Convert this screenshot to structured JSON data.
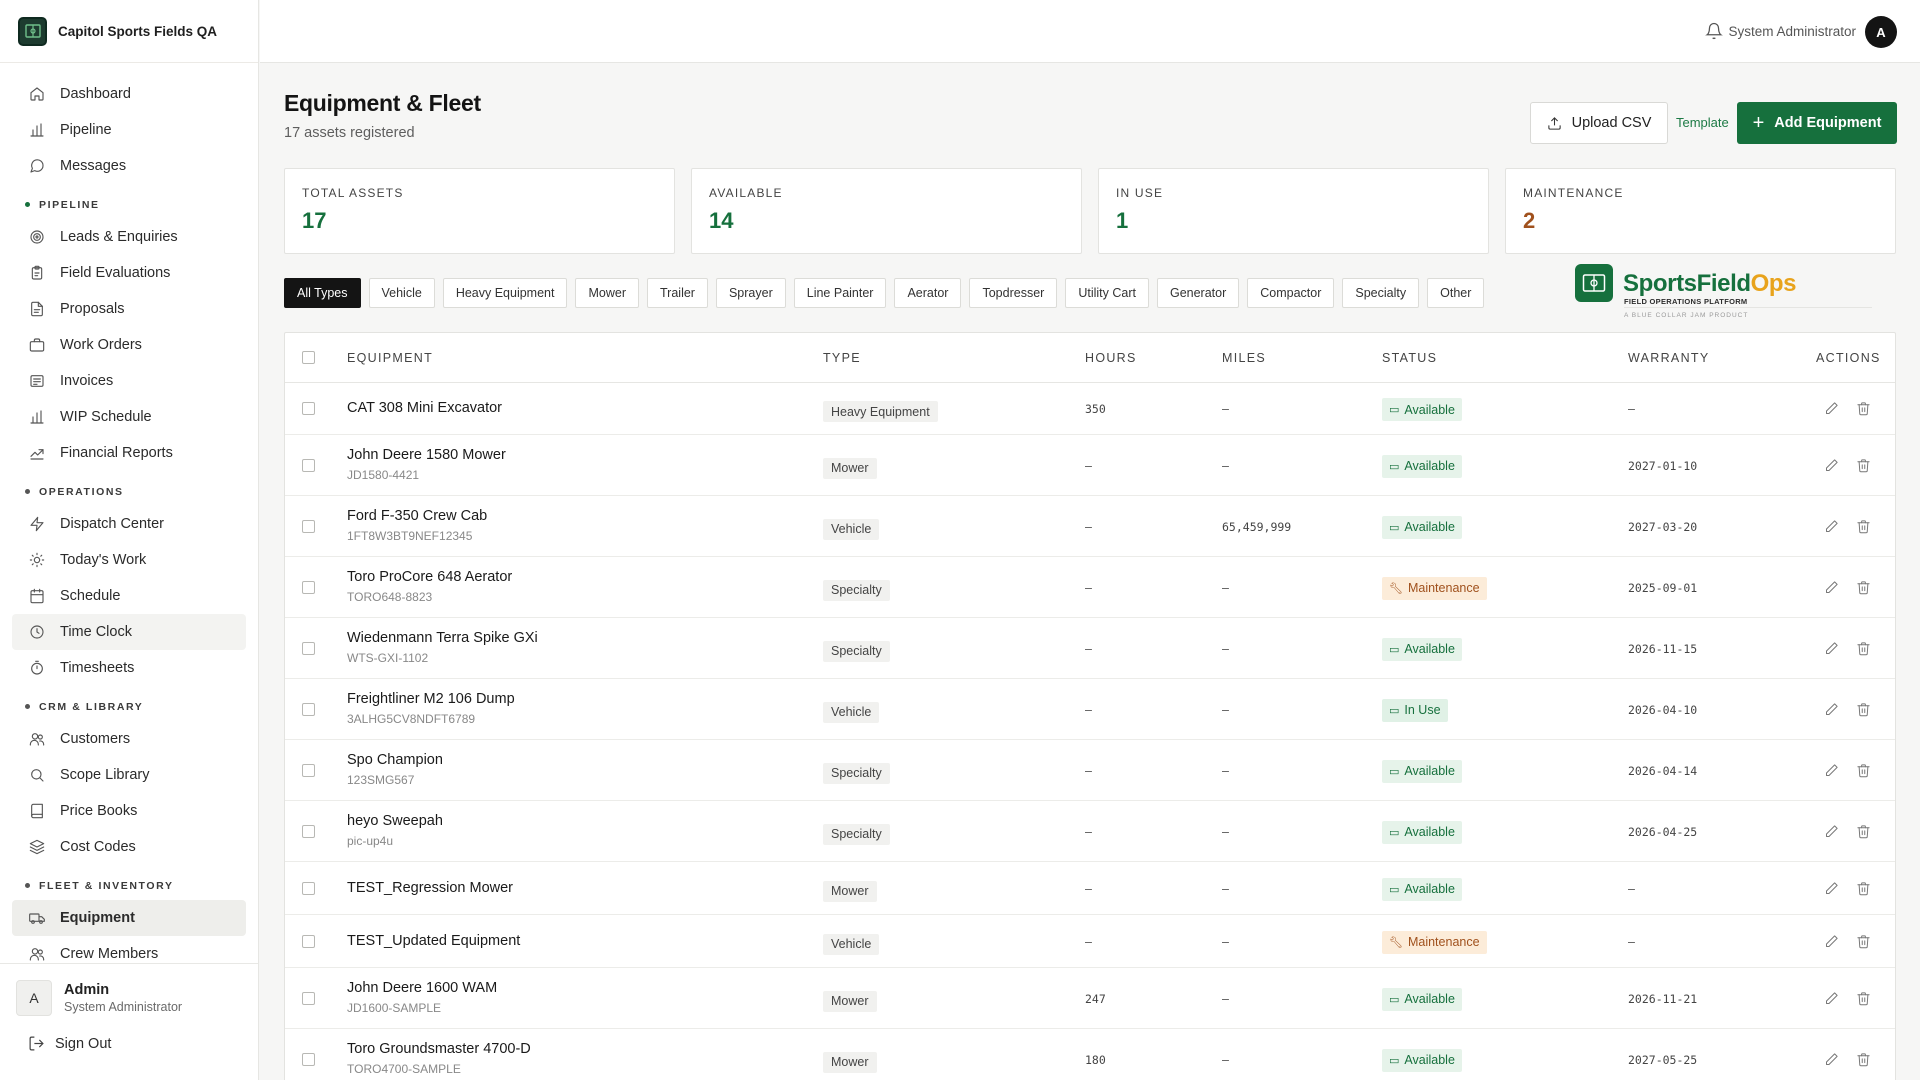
{
  "brand": {
    "name": "Capitol Sports Fields QA"
  },
  "nav": {
    "top": [
      {
        "label": "Dashboard",
        "icon": "home-icon"
      },
      {
        "label": "Pipeline",
        "icon": "bar-chart-icon"
      },
      {
        "label": "Messages",
        "icon": "message-icon"
      }
    ],
    "sections": [
      {
        "title": "PIPELINE",
        "dot": "#16703d",
        "items": [
          {
            "label": "Leads & Enquiries",
            "icon": "target-icon"
          },
          {
            "label": "Field Evaluations",
            "icon": "clipboard-icon"
          },
          {
            "label": "Proposals",
            "icon": "document-icon"
          },
          {
            "label": "Work Orders",
            "icon": "briefcase-icon"
          },
          {
            "label": "Invoices",
            "icon": "invoice-icon"
          },
          {
            "label": "WIP Schedule",
            "icon": "bar-chart-icon"
          },
          {
            "label": "Financial Reports",
            "icon": "trend-icon"
          }
        ]
      },
      {
        "title": "OPERATIONS",
        "dot": "#555555",
        "items": [
          {
            "label": "Dispatch Center",
            "icon": "lightning-icon"
          },
          {
            "label": "Today's Work",
            "icon": "sun-icon"
          },
          {
            "label": "Schedule",
            "icon": "calendar-icon"
          },
          {
            "label": "Time Clock",
            "icon": "clock-icon"
          },
          {
            "label": "Timesheets",
            "icon": "stopwatch-icon"
          }
        ]
      },
      {
        "title": "CRM & LIBRARY",
        "dot": "#555555",
        "items": [
          {
            "label": "Customers",
            "icon": "users-icon"
          },
          {
            "label": "Scope Library",
            "icon": "search-icon"
          },
          {
            "label": "Price Books",
            "icon": "book-icon"
          },
          {
            "label": "Cost Codes",
            "icon": "layers-icon"
          }
        ]
      },
      {
        "title": "FLEET & INVENTORY",
        "dot": "#555555",
        "items": [
          {
            "label": "Equipment",
            "icon": "truck-icon"
          },
          {
            "label": "Crew Members",
            "icon": "users-icon"
          }
        ]
      }
    ]
  },
  "footer": {
    "avatar": "A",
    "name": "Admin",
    "role": "System Administrator",
    "signout": "Sign Out"
  },
  "topbar": {
    "user": "System Administrator",
    "avatar": "A"
  },
  "page": {
    "title": "Equipment & Fleet",
    "subtitle": "17 assets registered",
    "upload_label": "Upload CSV",
    "template_label": "Template",
    "add_label": "Add Equipment"
  },
  "stats": [
    {
      "label": "TOTAL ASSETS",
      "value": "17",
      "color": "#16703d"
    },
    {
      "label": "AVAILABLE",
      "value": "14",
      "color": "#16703d"
    },
    {
      "label": "IN USE",
      "value": "1",
      "color": "#16703d"
    },
    {
      "label": "MAINTENANCE",
      "value": "2",
      "color": "#a0511d"
    }
  ],
  "filters": [
    "All Types",
    "Vehicle",
    "Heavy Equipment",
    "Mower",
    "Trailer",
    "Sprayer",
    "Line Painter",
    "Aerator",
    "Topdresser",
    "Utility Cart",
    "Generator",
    "Compactor",
    "Specialty",
    "Other"
  ],
  "ops_logo": {
    "name_a": "SportsField",
    "name_b": "Ops",
    "tagline": "FIELD OPERATIONS PLATFORM",
    "sub": "A BLUE COLLAR JAM PRODUCT"
  },
  "table": {
    "headers": {
      "equipment": "EQUIPMENT",
      "type": "TYPE",
      "hours": "HOURS",
      "miles": "MILES",
      "status": "STATUS",
      "warranty": "WARRANTY",
      "actions": "ACTIONS"
    },
    "rows": [
      {
        "name": "CAT 308 Mini Excavator",
        "sub": "",
        "type": "Heavy Equipment",
        "hours": "350",
        "miles": "–",
        "status": "Available",
        "warranty": "–"
      },
      {
        "name": "John Deere 1580 Mower",
        "sub": "JD1580-4421",
        "type": "Mower",
        "hours": "–",
        "miles": "–",
        "status": "Available",
        "warranty": "2027-01-10"
      },
      {
        "name": "Ford F-350 Crew Cab",
        "sub": "1FT8W3BT9NEF12345",
        "type": "Vehicle",
        "hours": "–",
        "miles": "65,459,999",
        "status": "Available",
        "warranty": "2027-03-20"
      },
      {
        "name": "Toro ProCore 648 Aerator",
        "sub": "TORO648-8823",
        "type": "Specialty",
        "hours": "–",
        "miles": "–",
        "status": "Maintenance",
        "warranty": "2025-09-01"
      },
      {
        "name": "Wiedenmann Terra Spike GXi",
        "sub": "WTS-GXI-1102",
        "type": "Specialty",
        "hours": "–",
        "miles": "–",
        "status": "Available",
        "warranty": "2026-11-15"
      },
      {
        "name": "Freightliner M2 106 Dump",
        "sub": "3ALHG5CV8NDFT6789",
        "type": "Vehicle",
        "hours": "–",
        "miles": "–",
        "status": "In Use",
        "warranty": "2026-04-10"
      },
      {
        "name": "Spo Champion",
        "sub": "123SMG567",
        "type": "Specialty",
        "hours": "–",
        "miles": "–",
        "status": "Available",
        "warranty": "2026-04-14"
      },
      {
        "name": "heyo Sweepah",
        "sub": "pic-up4u",
        "type": "Specialty",
        "hours": "–",
        "miles": "–",
        "status": "Available",
        "warranty": "2026-04-25"
      },
      {
        "name": "TEST_Regression Mower",
        "sub": "",
        "type": "Mower",
        "hours": "–",
        "miles": "–",
        "status": "Available",
        "warranty": "–"
      },
      {
        "name": "TEST_Updated Equipment",
        "sub": "",
        "type": "Vehicle",
        "hours": "–",
        "miles": "–",
        "status": "Maintenance",
        "warranty": "–"
      },
      {
        "name": "John Deere 1600 WAM",
        "sub": "JD1600-SAMPLE",
        "type": "Mower",
        "hours": "247",
        "miles": "–",
        "status": "Available",
        "warranty": "2026-11-21"
      },
      {
        "name": "Toro Groundsmaster 4700-D",
        "sub": "TORO4700-SAMPLE",
        "type": "Mower",
        "hours": "180",
        "miles": "–",
        "status": "Available",
        "warranty": "2027-05-25"
      }
    ]
  }
}
